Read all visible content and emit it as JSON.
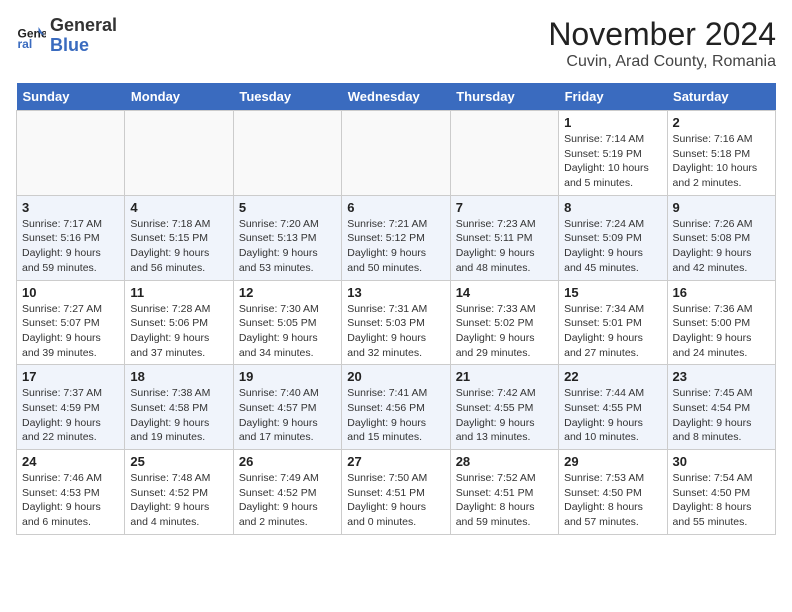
{
  "header": {
    "logo_line1": "General",
    "logo_line2": "Blue",
    "month": "November 2024",
    "location": "Cuvin, Arad County, Romania"
  },
  "days_of_week": [
    "Sunday",
    "Monday",
    "Tuesday",
    "Wednesday",
    "Thursday",
    "Friday",
    "Saturday"
  ],
  "weeks": [
    [
      {
        "day": "",
        "info": ""
      },
      {
        "day": "",
        "info": ""
      },
      {
        "day": "",
        "info": ""
      },
      {
        "day": "",
        "info": ""
      },
      {
        "day": "",
        "info": ""
      },
      {
        "day": "1",
        "info": "Sunrise: 7:14 AM\nSunset: 5:19 PM\nDaylight: 10 hours and 5 minutes."
      },
      {
        "day": "2",
        "info": "Sunrise: 7:16 AM\nSunset: 5:18 PM\nDaylight: 10 hours and 2 minutes."
      }
    ],
    [
      {
        "day": "3",
        "info": "Sunrise: 7:17 AM\nSunset: 5:16 PM\nDaylight: 9 hours and 59 minutes."
      },
      {
        "day": "4",
        "info": "Sunrise: 7:18 AM\nSunset: 5:15 PM\nDaylight: 9 hours and 56 minutes."
      },
      {
        "day": "5",
        "info": "Sunrise: 7:20 AM\nSunset: 5:13 PM\nDaylight: 9 hours and 53 minutes."
      },
      {
        "day": "6",
        "info": "Sunrise: 7:21 AM\nSunset: 5:12 PM\nDaylight: 9 hours and 50 minutes."
      },
      {
        "day": "7",
        "info": "Sunrise: 7:23 AM\nSunset: 5:11 PM\nDaylight: 9 hours and 48 minutes."
      },
      {
        "day": "8",
        "info": "Sunrise: 7:24 AM\nSunset: 5:09 PM\nDaylight: 9 hours and 45 minutes."
      },
      {
        "day": "9",
        "info": "Sunrise: 7:26 AM\nSunset: 5:08 PM\nDaylight: 9 hours and 42 minutes."
      }
    ],
    [
      {
        "day": "10",
        "info": "Sunrise: 7:27 AM\nSunset: 5:07 PM\nDaylight: 9 hours and 39 minutes."
      },
      {
        "day": "11",
        "info": "Sunrise: 7:28 AM\nSunset: 5:06 PM\nDaylight: 9 hours and 37 minutes."
      },
      {
        "day": "12",
        "info": "Sunrise: 7:30 AM\nSunset: 5:05 PM\nDaylight: 9 hours and 34 minutes."
      },
      {
        "day": "13",
        "info": "Sunrise: 7:31 AM\nSunset: 5:03 PM\nDaylight: 9 hours and 32 minutes."
      },
      {
        "day": "14",
        "info": "Sunrise: 7:33 AM\nSunset: 5:02 PM\nDaylight: 9 hours and 29 minutes."
      },
      {
        "day": "15",
        "info": "Sunrise: 7:34 AM\nSunset: 5:01 PM\nDaylight: 9 hours and 27 minutes."
      },
      {
        "day": "16",
        "info": "Sunrise: 7:36 AM\nSunset: 5:00 PM\nDaylight: 9 hours and 24 minutes."
      }
    ],
    [
      {
        "day": "17",
        "info": "Sunrise: 7:37 AM\nSunset: 4:59 PM\nDaylight: 9 hours and 22 minutes."
      },
      {
        "day": "18",
        "info": "Sunrise: 7:38 AM\nSunset: 4:58 PM\nDaylight: 9 hours and 19 minutes."
      },
      {
        "day": "19",
        "info": "Sunrise: 7:40 AM\nSunset: 4:57 PM\nDaylight: 9 hours and 17 minutes."
      },
      {
        "day": "20",
        "info": "Sunrise: 7:41 AM\nSunset: 4:56 PM\nDaylight: 9 hours and 15 minutes."
      },
      {
        "day": "21",
        "info": "Sunrise: 7:42 AM\nSunset: 4:55 PM\nDaylight: 9 hours and 13 minutes."
      },
      {
        "day": "22",
        "info": "Sunrise: 7:44 AM\nSunset: 4:55 PM\nDaylight: 9 hours and 10 minutes."
      },
      {
        "day": "23",
        "info": "Sunrise: 7:45 AM\nSunset: 4:54 PM\nDaylight: 9 hours and 8 minutes."
      }
    ],
    [
      {
        "day": "24",
        "info": "Sunrise: 7:46 AM\nSunset: 4:53 PM\nDaylight: 9 hours and 6 minutes."
      },
      {
        "day": "25",
        "info": "Sunrise: 7:48 AM\nSunset: 4:52 PM\nDaylight: 9 hours and 4 minutes."
      },
      {
        "day": "26",
        "info": "Sunrise: 7:49 AM\nSunset: 4:52 PM\nDaylight: 9 hours and 2 minutes."
      },
      {
        "day": "27",
        "info": "Sunrise: 7:50 AM\nSunset: 4:51 PM\nDaylight: 9 hours and 0 minutes."
      },
      {
        "day": "28",
        "info": "Sunrise: 7:52 AM\nSunset: 4:51 PM\nDaylight: 8 hours and 59 minutes."
      },
      {
        "day": "29",
        "info": "Sunrise: 7:53 AM\nSunset: 4:50 PM\nDaylight: 8 hours and 57 minutes."
      },
      {
        "day": "30",
        "info": "Sunrise: 7:54 AM\nSunset: 4:50 PM\nDaylight: 8 hours and 55 minutes."
      }
    ]
  ]
}
